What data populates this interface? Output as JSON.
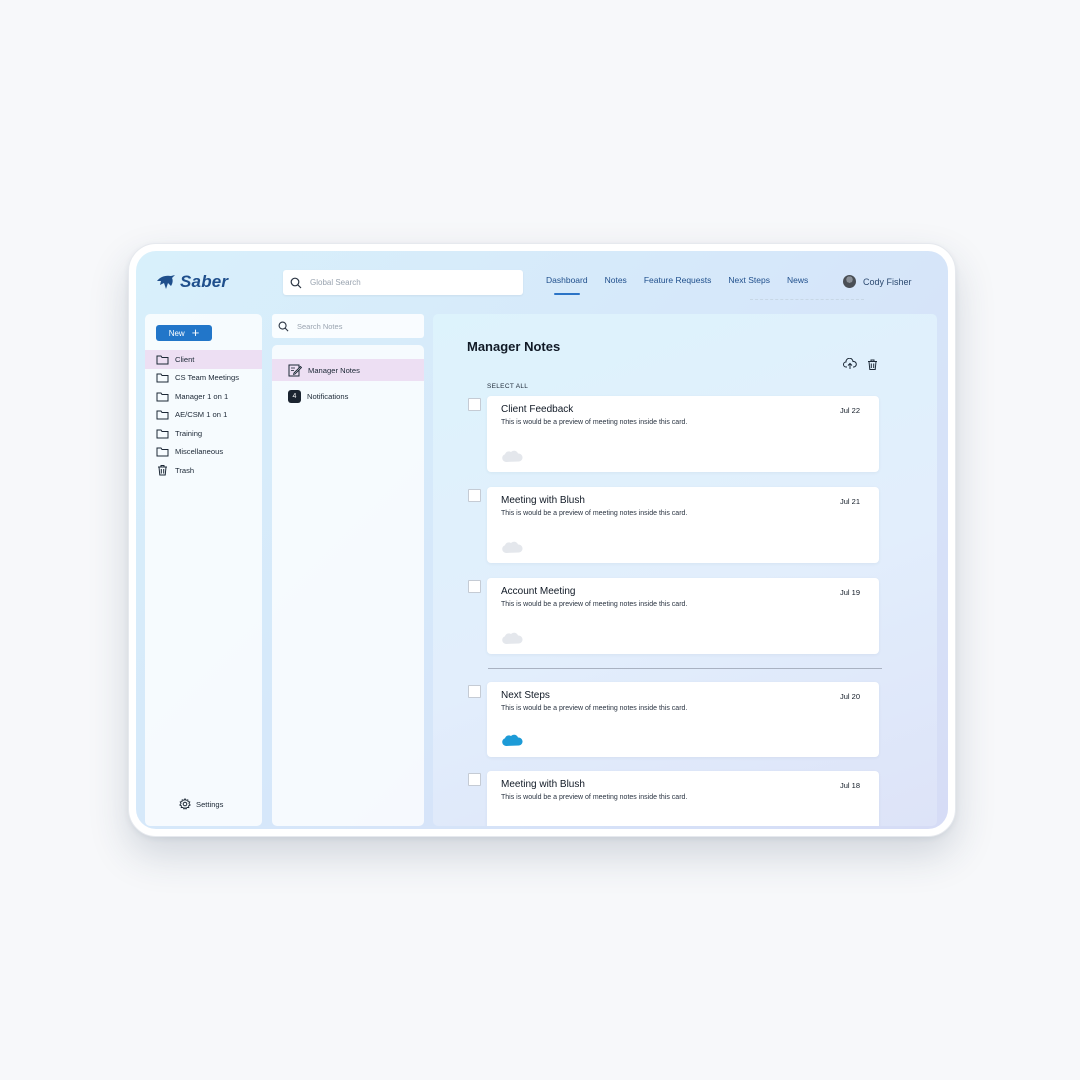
{
  "app": {
    "name": "Saber"
  },
  "header": {
    "search_placeholder": "Global Search",
    "nav": [
      {
        "label": "Dashboard",
        "active": true
      },
      {
        "label": "Notes",
        "active": false
      },
      {
        "label": "Feature Requests",
        "active": false
      },
      {
        "label": "Next Steps",
        "active": false
      },
      {
        "label": "News",
        "active": false
      }
    ],
    "user_name": "Cody Fisher"
  },
  "sidebar": {
    "new_label": "New",
    "items": [
      {
        "label": "Client",
        "icon": "folder-icon",
        "active": true
      },
      {
        "label": "CS Team Meetings",
        "icon": "folder-icon",
        "active": false
      },
      {
        "label": "Manager 1 on 1",
        "icon": "folder-icon",
        "active": false
      },
      {
        "label": "AE/CSM 1 on 1",
        "icon": "folder-icon",
        "active": false
      },
      {
        "label": "Training",
        "icon": "folder-icon",
        "active": false
      },
      {
        "label": "Miscellaneous",
        "icon": "folder-icon",
        "active": false
      },
      {
        "label": "Trash",
        "icon": "trash-icon",
        "active": false
      }
    ],
    "settings_label": "Settings"
  },
  "middle": {
    "search_placeholder": "Search Notes",
    "items": [
      {
        "label": "Manager Notes",
        "icon": "edit-note-icon",
        "active": true
      },
      {
        "label": "Notifications",
        "badge": "4",
        "active": false
      }
    ]
  },
  "main": {
    "title": "Manager Notes",
    "select_all": "SELECT ALL",
    "cards": [
      {
        "title": "Client Feedback",
        "date": "Jul 22",
        "preview": "This is would be a preview of meeting notes inside this card.",
        "cloud_active": false
      },
      {
        "title": "Meeting with Blush",
        "date": "Jul 21",
        "preview": "This is would be a preview of meeting notes inside this card.",
        "cloud_active": false
      },
      {
        "title": "Account Meeting",
        "date": "Jul 19",
        "preview": "This is would be a preview of meeting notes inside this card.",
        "cloud_active": false
      },
      {
        "title": "Next Steps",
        "date": "Jul 20",
        "preview": "This is would be a preview of meeting notes inside this card.",
        "cloud_active": true
      },
      {
        "title": "Meeting with Blush",
        "date": "Jul 18",
        "preview": "This is would be a preview of meeting notes inside this card.",
        "cloud_active": false
      }
    ]
  },
  "colors": {
    "accent": "#2276c9",
    "active_row": "#eddff3",
    "brand_text": "#1f4f8c",
    "cloud_inactive": "#e4e7ec",
    "cloud_active": "#1d9bd7"
  }
}
